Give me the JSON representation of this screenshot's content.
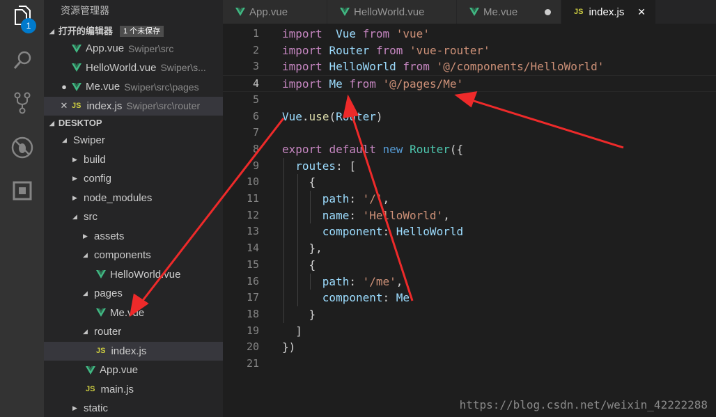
{
  "activity": {
    "badge": "1"
  },
  "sidebar": {
    "title": "资源管理器",
    "open_editors": {
      "header": "打开的编辑器",
      "unsaved": "1 个未保存",
      "items": [
        {
          "mark": "",
          "icon": "vue",
          "name": "App.vue",
          "path": "Swiper\\src"
        },
        {
          "mark": "",
          "icon": "vue",
          "name": "HelloWorld.vue",
          "path": "Swiper\\s..."
        },
        {
          "mark": "●",
          "icon": "vue",
          "name": "Me.vue",
          "path": "Swiper\\src\\pages"
        },
        {
          "mark": "✕",
          "icon": "js",
          "name": "index.js",
          "path": "Swiper\\src\\router"
        }
      ]
    },
    "desktop": {
      "header": "DESKTOP",
      "tree": [
        {
          "label": "Swiper",
          "type": "open"
        },
        {
          "label": "build",
          "type": "closed"
        },
        {
          "label": "config",
          "type": "closed"
        },
        {
          "label": "node_modules",
          "type": "closed"
        },
        {
          "label": "src",
          "type": "open"
        },
        {
          "label": "assets",
          "type": "closed"
        },
        {
          "label": "components",
          "type": "open"
        },
        {
          "label": "HelloWorld.vue",
          "type": "vue"
        },
        {
          "label": "pages",
          "type": "open"
        },
        {
          "label": "Me.vue",
          "type": "vue"
        },
        {
          "label": "router",
          "type": "open"
        },
        {
          "label": "index.js",
          "type": "js"
        },
        {
          "label": "App.vue",
          "type": "vue"
        },
        {
          "label": "main.js",
          "type": "js"
        },
        {
          "label": "static",
          "type": "closed"
        }
      ]
    }
  },
  "tabs": [
    {
      "label": "App.vue",
      "icon": "vue",
      "state": ""
    },
    {
      "label": "HelloWorld.vue",
      "icon": "vue",
      "state": ""
    },
    {
      "label": "Me.vue",
      "icon": "vue",
      "state": "dirty"
    },
    {
      "label": "index.js",
      "icon": "js",
      "state": "active"
    }
  ],
  "js_icon_text": "JS",
  "editor": {
    "current_line": 4,
    "lines": [
      [
        [
          "kw",
          "import"
        ],
        [
          "",
          "  "
        ],
        [
          "id",
          "Vue"
        ],
        [
          "",
          " "
        ],
        [
          "kw",
          "from"
        ],
        [
          "",
          " "
        ],
        [
          "str",
          "'vue'"
        ]
      ],
      [
        [
          "kw",
          "import"
        ],
        [
          "",
          " "
        ],
        [
          "id",
          "Router"
        ],
        [
          "",
          " "
        ],
        [
          "kw",
          "from"
        ],
        [
          "",
          " "
        ],
        [
          "str",
          "'vue-router'"
        ]
      ],
      [
        [
          "kw",
          "import"
        ],
        [
          "",
          " "
        ],
        [
          "id",
          "HelloWorld"
        ],
        [
          "",
          " "
        ],
        [
          "kw",
          "from"
        ],
        [
          "",
          " "
        ],
        [
          "str",
          "'@/components/HelloWorld'"
        ]
      ],
      [
        [
          "kw",
          "import"
        ],
        [
          "",
          " "
        ],
        [
          "id",
          "Me"
        ],
        [
          "",
          " "
        ],
        [
          "kw",
          "from"
        ],
        [
          "",
          " "
        ],
        [
          "str",
          "'@/pages/Me'"
        ]
      ],
      [],
      [
        [
          "id",
          "Vue"
        ],
        [
          "",
          "."
        ],
        [
          "fn",
          "use"
        ],
        [
          "",
          "("
        ],
        [
          "id",
          "Router"
        ],
        [
          "",
          ")"
        ]
      ],
      [],
      [
        [
          "kw",
          "export"
        ],
        [
          "",
          " "
        ],
        [
          "kw",
          "default"
        ],
        [
          "",
          " "
        ],
        [
          "kw2",
          "new"
        ],
        [
          "",
          " "
        ],
        [
          "cls",
          "Router"
        ],
        [
          "",
          "({"
        ]
      ],
      [
        [
          "",
          "  "
        ],
        [
          "id",
          "routes"
        ],
        [
          "",
          ": ["
        ]
      ],
      [
        [
          "",
          "    {"
        ]
      ],
      [
        [
          "",
          "      "
        ],
        [
          "id",
          "path"
        ],
        [
          "",
          ": "
        ],
        [
          "str",
          "'/'"
        ],
        [
          "",
          ","
        ]
      ],
      [
        [
          "",
          "      "
        ],
        [
          "id",
          "name"
        ],
        [
          "",
          ": "
        ],
        [
          "str",
          "'HelloWorld'"
        ],
        [
          "",
          ","
        ]
      ],
      [
        [
          "",
          "      "
        ],
        [
          "id",
          "component"
        ],
        [
          "",
          ": "
        ],
        [
          "id",
          "HelloWorld"
        ]
      ],
      [
        [
          "",
          "    },"
        ]
      ],
      [
        [
          "",
          "    {"
        ]
      ],
      [
        [
          "",
          "      "
        ],
        [
          "id",
          "path"
        ],
        [
          "",
          ": "
        ],
        [
          "str",
          "'/me'"
        ],
        [
          "",
          ","
        ]
      ],
      [
        [
          "",
          "      "
        ],
        [
          "id",
          "component"
        ],
        [
          "",
          ": "
        ],
        [
          "id",
          "Me"
        ]
      ],
      [
        [
          "",
          "    }"
        ]
      ],
      [
        [
          "",
          "  ]"
        ]
      ],
      [
        [
          "",
          "})"
        ]
      ],
      []
    ]
  },
  "watermark": "https://blog.csdn.net/weixin_42222288",
  "colors": {
    "accent": "#007acc",
    "arrow": "#ee2a2a",
    "vue_green": "#41b883",
    "js_yellow": "#cbcb41"
  }
}
